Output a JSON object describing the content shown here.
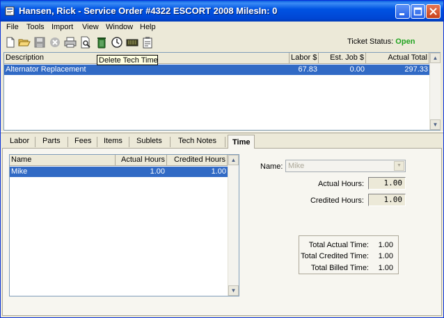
{
  "window": {
    "title": "Hansen, Rick - Service Order #4322   ESCORT 2008   MilesIn: 0"
  },
  "menu": [
    "File",
    "Tools",
    "Import",
    "View",
    "Window",
    "Help"
  ],
  "toolbar": {
    "icons": [
      "new-icon",
      "open-icon",
      "save-icon",
      "cancel-icon",
      "print-icon",
      "print-preview-icon",
      "delete-icon",
      "clock-icon",
      "keyboard-icon",
      "clipboard-icon"
    ],
    "tooltip": "Delete Tech Time"
  },
  "ticket_status": {
    "label": "Ticket Status:",
    "value": "Open",
    "value_color": "#1EA31E"
  },
  "jobs_grid": {
    "columns": [
      "Description",
      "Labor $",
      "Est. Job $",
      "Actual Total"
    ],
    "rows": [
      {
        "description": "Alternator Replacement",
        "labor": "67.83",
        "est_job": "0.00",
        "actual_total": "297.33"
      }
    ]
  },
  "tabs": [
    {
      "label": "Labor",
      "active": false
    },
    {
      "label": "Parts",
      "active": false
    },
    {
      "label": "Fees",
      "active": false
    },
    {
      "label": "Items",
      "active": false
    },
    {
      "label": "Sublets",
      "active": false
    },
    {
      "label": "Tech Notes",
      "active": false
    },
    {
      "label": "Time",
      "active": true
    }
  ],
  "time_grid": {
    "columns": [
      "Name",
      "Actual Hours",
      "Credited Hours"
    ],
    "rows": [
      {
        "name": "Mike",
        "actual_hours": "1.00",
        "credited_hours": "1.00"
      }
    ]
  },
  "time_form": {
    "name_label": "Name:",
    "name_value": "Mike",
    "actual_label": "Actual Hours:",
    "actual_value": "1.00",
    "credited_label": "Credited Hours:",
    "credited_value": "1.00"
  },
  "totals": {
    "actual_label": "Total Actual Time:",
    "actual_value": "1.00",
    "credited_label": "Total Credited Time:",
    "credited_value": "1.00",
    "billed_label": "Total Billed Time:",
    "billed_value": "1.00"
  },
  "colors": {
    "selection": "#316AC5",
    "titlebar": "#0054E3"
  }
}
